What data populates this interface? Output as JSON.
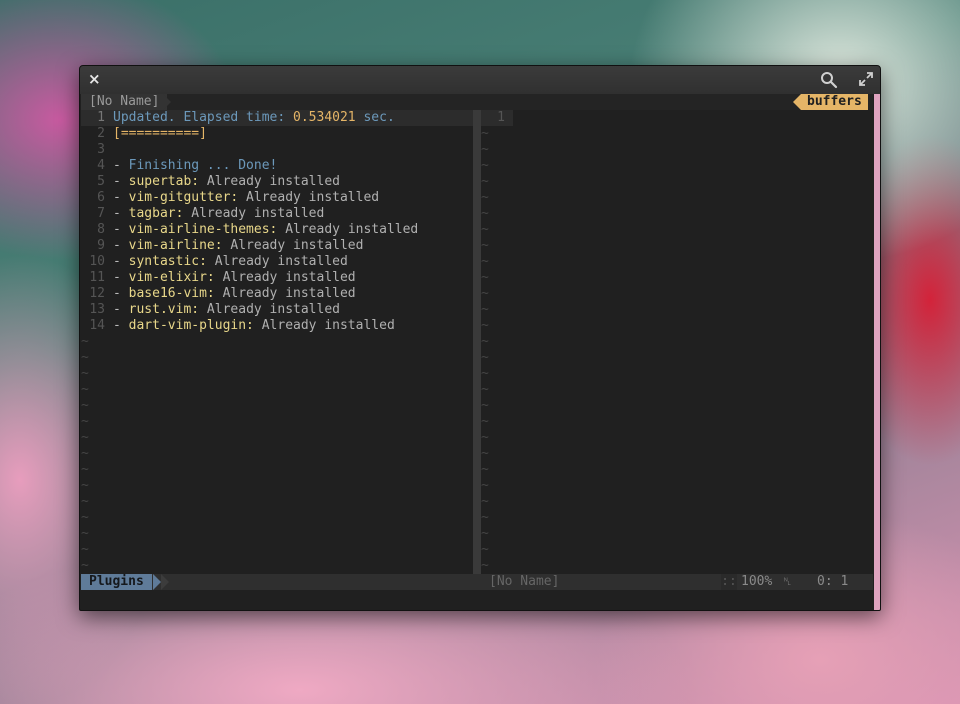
{
  "window": {
    "close_glyph": "×",
    "search_icon": "search-icon",
    "maximize_icon": "maximize-icon"
  },
  "tabline": {
    "left_tab": "[No Name]",
    "right_tab": "buffers"
  },
  "left_pane": {
    "lines": [
      {
        "n": "1",
        "parts": [
          {
            "t": "Updated. Elapsed time: ",
            "c": "c-upd"
          },
          {
            "t": "0.534021",
            "c": "c-num"
          },
          {
            "t": " sec.",
            "c": "c-upd"
          }
        ]
      },
      {
        "n": "2",
        "parts": [
          {
            "t": "[==========]",
            "c": "c-bar"
          }
        ]
      },
      {
        "n": "3",
        "parts": []
      },
      {
        "n": "4",
        "parts": [
          {
            "t": "- ",
            "c": "c-plain"
          },
          {
            "t": "Finishing ... Done!",
            "c": "c-fin"
          }
        ]
      },
      {
        "n": "5",
        "parts": [
          {
            "t": "- ",
            "c": "c-plain"
          },
          {
            "t": "supertab:",
            "c": "c-name"
          },
          {
            "t": " Already installed",
            "c": "c-txt"
          }
        ]
      },
      {
        "n": "6",
        "parts": [
          {
            "t": "- ",
            "c": "c-plain"
          },
          {
            "t": "vim-gitgutter:",
            "c": "c-name"
          },
          {
            "t": " Already installed",
            "c": "c-txt"
          }
        ]
      },
      {
        "n": "7",
        "parts": [
          {
            "t": "- ",
            "c": "c-plain"
          },
          {
            "t": "tagbar:",
            "c": "c-name"
          },
          {
            "t": " Already installed",
            "c": "c-txt"
          }
        ]
      },
      {
        "n": "8",
        "parts": [
          {
            "t": "- ",
            "c": "c-plain"
          },
          {
            "t": "vim-airline-themes:",
            "c": "c-name"
          },
          {
            "t": " Already installed",
            "c": "c-txt"
          }
        ]
      },
      {
        "n": "9",
        "parts": [
          {
            "t": "- ",
            "c": "c-plain"
          },
          {
            "t": "vim-airline:",
            "c": "c-name"
          },
          {
            "t": " Already installed",
            "c": "c-txt"
          }
        ]
      },
      {
        "n": "10",
        "parts": [
          {
            "t": "- ",
            "c": "c-plain"
          },
          {
            "t": "syntastic:",
            "c": "c-name"
          },
          {
            "t": " Already installed",
            "c": "c-txt"
          }
        ]
      },
      {
        "n": "11",
        "parts": [
          {
            "t": "- ",
            "c": "c-plain"
          },
          {
            "t": "vim-elixir:",
            "c": "c-name"
          },
          {
            "t": " Already installed",
            "c": "c-txt"
          }
        ]
      },
      {
        "n": "12",
        "parts": [
          {
            "t": "- ",
            "c": "c-plain"
          },
          {
            "t": "base16-vim:",
            "c": "c-name"
          },
          {
            "t": " Already installed",
            "c": "c-txt"
          }
        ]
      },
      {
        "n": "13",
        "parts": [
          {
            "t": "- ",
            "c": "c-plain"
          },
          {
            "t": "rust.vim:",
            "c": "c-name"
          },
          {
            "t": " Already installed",
            "c": "c-txt"
          }
        ]
      },
      {
        "n": "14",
        "parts": [
          {
            "t": "- ",
            "c": "c-plain"
          },
          {
            "t": "dart-vim-plugin:",
            "c": "c-name"
          },
          {
            "t": " Already installed",
            "c": "c-txt"
          }
        ]
      }
    ],
    "empty_marker": "~"
  },
  "right_pane": {
    "line_number": "1",
    "empty_marker": "~"
  },
  "statusbar": {
    "left_mode": "Plugins",
    "right_filename": "[No Name]",
    "separator_glyph": "::",
    "percent": "100%",
    "line_icon_glyph": "␤",
    "position": "0:  1"
  }
}
